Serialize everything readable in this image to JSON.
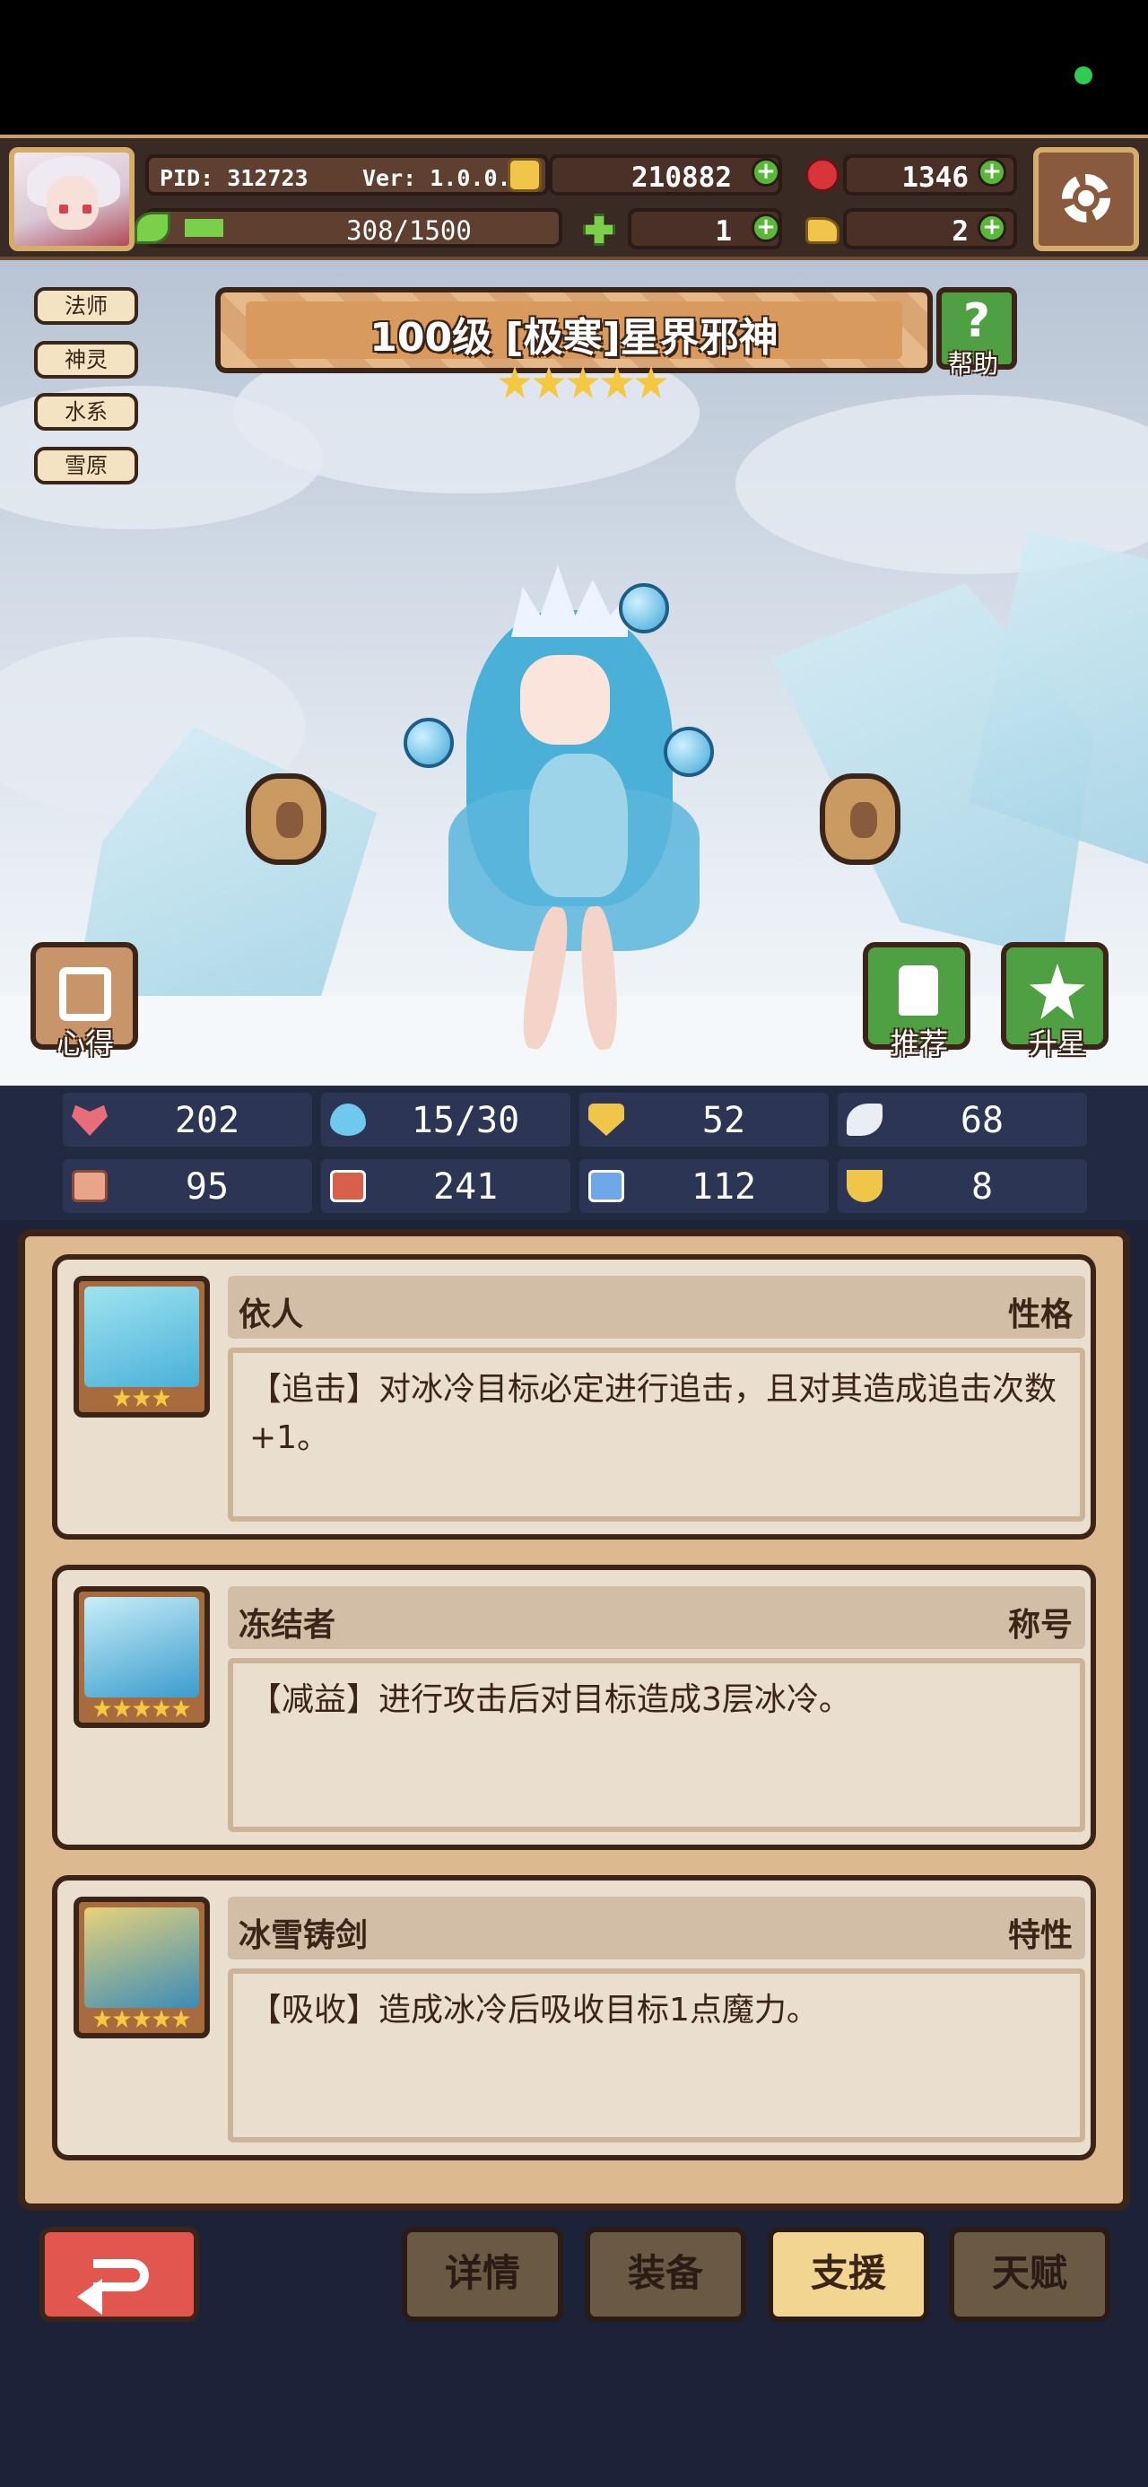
{
  "player": {
    "pid": "PID: 312723",
    "version": "Ver: 1.0.0.9",
    "exp_text": "308/1500",
    "exp_progress": 0.205
  },
  "resources": {
    "gold": "210882",
    "gems": "1346",
    "clover": "1",
    "keys": "2"
  },
  "hero": {
    "title": "100级 [极寒]星界邪神",
    "stars": 5,
    "tags": [
      "法师",
      "神灵",
      "水系",
      "雪原"
    ],
    "help_label": "帮助",
    "notes_label": "心得",
    "recommend_label": "推荐",
    "star_up_label": "升星"
  },
  "stats": [
    {
      "icon": "heart-icon",
      "value": "202",
      "color": "#e86d7a"
    },
    {
      "icon": "water-drop-icon",
      "value": "15/30",
      "color": "#6fc8ee"
    },
    {
      "icon": "shield-icon",
      "value": "52",
      "color": "#f0c64a"
    },
    {
      "icon": "wing-icon",
      "value": "68",
      "color": "#e8eef4"
    },
    {
      "icon": "fist-icon",
      "value": "95",
      "color": "#e8a58a"
    },
    {
      "icon": "book-icon",
      "value": "241",
      "color": "#d8604a"
    },
    {
      "icon": "stairs-icon",
      "value": "112",
      "color": "#6fa8e8"
    },
    {
      "icon": "magnet-icon",
      "value": "8",
      "color": "#f0c64a"
    }
  ],
  "cards": [
    {
      "name": "依人",
      "type": "性格",
      "stars": 3,
      "desc": "【追击】对冰冷目标必定进行追击，且对其造成追击次数+1。"
    },
    {
      "name": "冻结者",
      "type": "称号",
      "stars": 5,
      "desc": "【减益】进行攻击后对目标造成3层冰冷。"
    },
    {
      "name": "冰雪铸剑",
      "type": "特性",
      "stars": 5,
      "desc": "【吸收】造成冰冷后吸收目标1点魔力。"
    }
  ],
  "tabs": [
    "详情",
    "装备",
    "支援",
    "天赋"
  ],
  "active_tab": "支援",
  "colors": {
    "accent_gold": "#d6ac6a",
    "panel": "#dcb98e",
    "active_tab": "#f2d590",
    "back_button": "#e25650"
  }
}
